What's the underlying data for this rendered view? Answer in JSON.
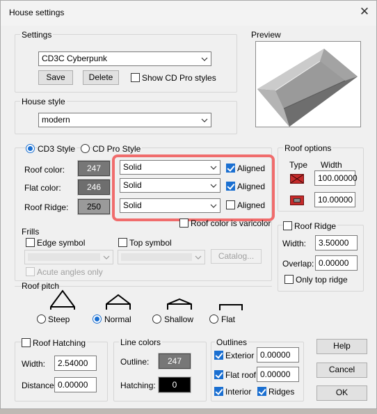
{
  "window": {
    "title": "House settings"
  },
  "settings": {
    "label": "Settings",
    "style_value": "CD3C Cyberpunk",
    "save": "Save",
    "delete": "Delete",
    "show_pro": "Show CD Pro styles"
  },
  "preview": {
    "label": "Preview"
  },
  "house_style": {
    "label": "House style",
    "value": "modern"
  },
  "style_mode": {
    "cd3": "CD3 Style",
    "cdpro": "CD Pro Style"
  },
  "colors": {
    "roof": {
      "label": "Roof color:",
      "value": "247",
      "pattern": "Solid",
      "aligned": "Aligned"
    },
    "flat": {
      "label": "Flat color:",
      "value": "246",
      "pattern": "Solid",
      "aligned": "Aligned"
    },
    "ridge": {
      "label": "Roof Ridge:",
      "value": "250",
      "pattern": "Solid",
      "aligned": "Aligned"
    },
    "varicolor": "Roof color is varicolor"
  },
  "roof_options": {
    "label": "Roof options",
    "type_header": "Type",
    "width_header": "Width",
    "width1": "100.00000",
    "width2": "10.00000"
  },
  "roof_ridge": {
    "label": "Roof Ridge",
    "width_label": "Width:",
    "width": "3.50000",
    "overlap_label": "Overlap:",
    "overlap": "0.00000",
    "only_top": "Only top ridge"
  },
  "frills": {
    "label": "Frills",
    "edge": "Edge symbol",
    "top": "Top symbol",
    "catalog": "Catalog...",
    "acute": "Acute angles only"
  },
  "roof_pitch": {
    "label": "Roof pitch",
    "steep": "Steep",
    "normal": "Normal",
    "shallow": "Shallow",
    "flat": "Flat"
  },
  "hatching": {
    "label": "Roof Hatching",
    "width_label": "Width:",
    "width": "2.54000",
    "distance_label": "Distance:",
    "distance": "0.00000"
  },
  "line_colors": {
    "label": "Line colors",
    "outline_label": "Outline:",
    "outline": "247",
    "hatching_label": "Hatching:",
    "hatching": "0"
  },
  "outlines": {
    "label": "Outlines",
    "exterior": "Exterior",
    "exterior_val": "0.00000",
    "flat_roof": "Flat roof",
    "flat_roof_val": "0.00000",
    "interior": "Interior",
    "ridges": "Ridges"
  },
  "buttons": {
    "help": "Help",
    "cancel": "Cancel",
    "ok": "OK"
  },
  "theme": {
    "swatch_gray": "#777777",
    "accent": "#1a6fd1",
    "highlight": "#f06c6c"
  }
}
